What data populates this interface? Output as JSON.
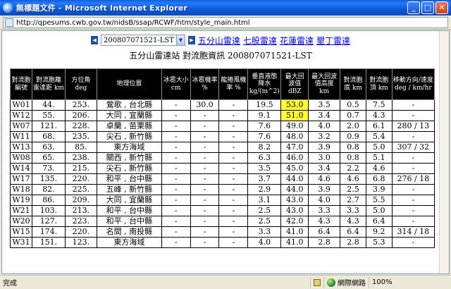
{
  "window": {
    "title": "無標題文件 - Microsoft Internet Explorer",
    "minimize": "_",
    "maximize": "□",
    "close": "✕"
  },
  "address": {
    "url": "http://qpesums.cwb.gov.tw/nidsB/ssap/RCWF/htm/style_main.html"
  },
  "nav": {
    "prev_arrow": "◀",
    "next_arrow": "▶",
    "selected_time": "200807071521-LST",
    "caret": "▼",
    "links": [
      "五分山雷達",
      "七股雷達",
      "花蓮雷達",
      "墾丁雷達"
    ]
  },
  "heading": "五分山雷達站 對流胞資訊 200807071521-LST",
  "table": {
    "headers": [
      "對流胞編號",
      "對流胞離雷達距 km",
      "方位角 deg",
      "地理位置",
      "冰雹大小 cm",
      "冰雹機率 %",
      "龍捲風機率 %",
      "垂直液態降水 kg/(m^2)",
      "最大回波值 dBZ",
      "最大回波值高度 km",
      "對流胞底 km",
      "對流胞頂 km",
      "移動方向/速度 deg / km/hr"
    ],
    "rows": [
      [
        "W01",
        "44.",
        "253.",
        "鶯歌 , 台北縣",
        "-",
        "30.0",
        "-",
        "19.5",
        "53.0",
        "3.5",
        "0.5",
        "7.5",
        "-"
      ],
      [
        "W12",
        "55.",
        "206.",
        "大同 , 宜蘭縣",
        "-",
        "-",
        "-",
        "9.1",
        "51.0",
        "3.4",
        "0.7",
        "4.3",
        "-"
      ],
      [
        "W07",
        "121.",
        "228.",
        "卓蘭 , 苗栗縣",
        "-",
        "-",
        "-",
        "7.6",
        "49.0",
        "4.0",
        "2.0",
        "6.1",
        "280 / 13"
      ],
      [
        "W11",
        "68.",
        "235.",
        "尖石 , 新竹縣",
        "-",
        "-",
        "-",
        "7.6",
        "48.0",
        "3.2",
        "0.9",
        "5.4",
        "-"
      ],
      [
        "W13",
        "63.",
        "85.",
        "東方海域",
        "-",
        "-",
        "-",
        "8.2",
        "47.0",
        "3.9",
        "0.8",
        "5.0",
        "307 / 32"
      ],
      [
        "W08",
        "65.",
        "238.",
        "關西 , 新竹縣",
        "-",
        "-",
        "-",
        "6.3",
        "46.0",
        "3.0",
        "0.8",
        "5.1",
        "-"
      ],
      [
        "W14",
        "73.",
        "215.",
        "尖石 , 新竹縣",
        "-",
        "-",
        "-",
        "3.5",
        "45.0",
        "3.4",
        "2.2",
        "4.6",
        "-"
      ],
      [
        "W17",
        "135.",
        "220.",
        "和平 , 台中縣",
        "-",
        "-",
        "-",
        "3.7",
        "44.0",
        "4.6",
        "4.6",
        "6.8",
        "276 / 18"
      ],
      [
        "W18",
        "82.",
        "225.",
        "五峰 , 新竹縣",
        "-",
        "-",
        "-",
        "2.9",
        "44.0",
        "3.9",
        "2.5",
        "3.9",
        "-"
      ],
      [
        "W19",
        "86.",
        "209.",
        "大同 , 宜蘭縣",
        "-",
        "-",
        "-",
        "3.1",
        "43.0",
        "4.0",
        "2.7",
        "5.5",
        "-"
      ],
      [
        "W21",
        "103.",
        "213.",
        "和平 , 台中縣",
        "-",
        "-",
        "-",
        "2.5",
        "43.0",
        "3.3",
        "3.3",
        "5.0",
        "-"
      ],
      [
        "W20",
        "127.",
        "223.",
        "和平 , 台中縣",
        "-",
        "-",
        "-",
        "2.5",
        "42.0",
        "4.3",
        "4.3",
        "6.4",
        "-"
      ],
      [
        "W15",
        "174.",
        "220.",
        "名間 , 南投縣",
        "-",
        "-",
        "-",
        "3.3",
        "41.0",
        "6.4",
        "6.4",
        "9.2",
        "314 / 18"
      ],
      [
        "W31",
        "151.",
        "123.",
        "東方海域",
        "-",
        "-",
        "-",
        "4.0",
        "41.0",
        "2.8",
        "2.8",
        "5.3",
        "-"
      ]
    ],
    "highlight_color": "#ffff33"
  },
  "status": {
    "text": "完成",
    "zone": "網際網路",
    "zoom": "100%"
  }
}
